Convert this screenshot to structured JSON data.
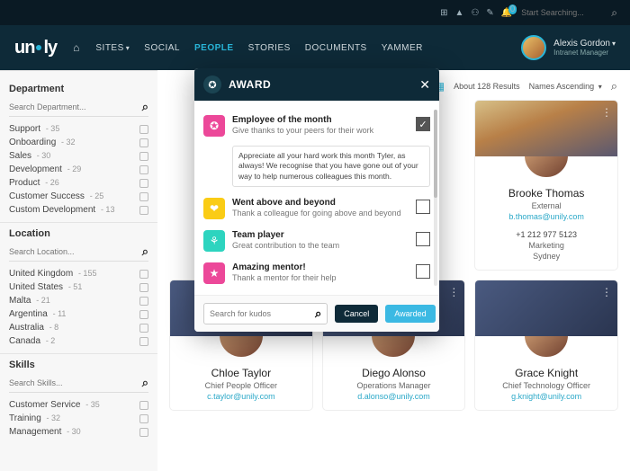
{
  "topbar": {
    "search_placeholder": "Start Searching...",
    "notification_count": "0"
  },
  "brand": "unily",
  "nav": {
    "home": "",
    "sites": "SITES",
    "social": "SOCIAL",
    "people": "PEOPLE",
    "stories": "STORIES",
    "documents": "DOCUMENTS",
    "yammer": "YAMMER"
  },
  "user": {
    "name": "Alexis Gordon",
    "role": "Intranet Manager"
  },
  "sidebar": {
    "department": {
      "title": "Department",
      "placeholder": "Search Department...",
      "items": [
        {
          "label": "Support",
          "count": "35"
        },
        {
          "label": "Onboarding",
          "count": "32"
        },
        {
          "label": "Sales",
          "count": "30"
        },
        {
          "label": "Development",
          "count": "29"
        },
        {
          "label": "Product",
          "count": "26"
        },
        {
          "label": "Customer Success",
          "count": "25"
        },
        {
          "label": "Custom Development",
          "count": "13"
        }
      ]
    },
    "location": {
      "title": "Location",
      "placeholder": "Search Location...",
      "items": [
        {
          "label": "United Kingdom",
          "count": "155"
        },
        {
          "label": "United States",
          "count": "51"
        },
        {
          "label": "Malta",
          "count": "21"
        },
        {
          "label": "Argentina",
          "count": "11"
        },
        {
          "label": "Australia",
          "count": "8"
        },
        {
          "label": "Canada",
          "count": "2"
        }
      ]
    },
    "skills": {
      "title": "Skills",
      "placeholder": "Search Skills...",
      "items": [
        {
          "label": "Customer Service",
          "count": "35"
        },
        {
          "label": "Training",
          "count": "32"
        },
        {
          "label": "Management",
          "count": "30"
        }
      ]
    }
  },
  "main": {
    "results": "About 128 Results",
    "sort": "Names Ascending"
  },
  "people": [
    {
      "name": "Brooke Thomas",
      "role": "External",
      "email": "b.thomas@unily.com",
      "phone": "+1 212 977 5123",
      "dept": "Marketing",
      "city": "Sydney"
    },
    {
      "name": "Chloe Taylor",
      "role": "Chief People Officer",
      "email": "c.taylor@unily.com"
    },
    {
      "name": "Diego Alonso",
      "role": "Operations Manager",
      "email": "d.alonso@unily.com"
    },
    {
      "name": "Grace Knight",
      "role": "Chief Technology Officer",
      "email": "g.knight@unily.com"
    }
  ],
  "modal": {
    "title": "AWARD",
    "note": "Appreciate all your hard work this month Tyler, as always! We recognise that you have gone out of your way to help numerous colleagues this month.",
    "search_placeholder": "Search for kudos",
    "cancel": "Cancel",
    "submit": "Awarded",
    "awards": [
      {
        "title": "Employee of the month",
        "sub": "Give thanks to your peers for their work",
        "checked": true,
        "color": "pink",
        "glyph": "✪"
      },
      {
        "title": "Went above and beyond",
        "sub": "Thank a colleague for going above and beyond",
        "checked": false,
        "color": "yellow",
        "glyph": "❤"
      },
      {
        "title": "Team player",
        "sub": "Great contribution to the team",
        "checked": false,
        "color": "teal",
        "glyph": "⚘"
      },
      {
        "title": "Amazing mentor!",
        "sub": "Thank a mentor for their help",
        "checked": false,
        "color": "pink",
        "glyph": "★"
      }
    ]
  }
}
